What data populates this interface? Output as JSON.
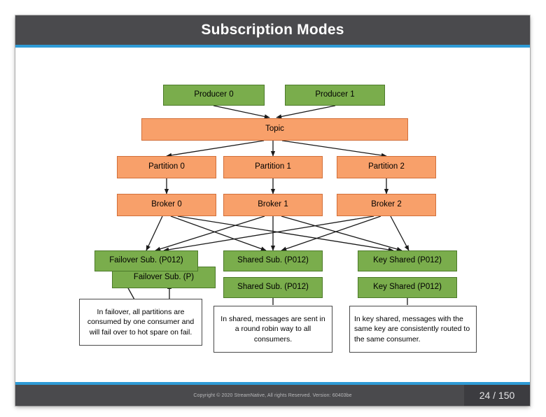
{
  "slide": {
    "title": "Subscription Modes",
    "counter": "24 / 150",
    "copyright": "Copyright © 2020 StreamNative, All rights Reserved. Version: 60403be",
    "accent_color": "#2e9bd6",
    "header_color": "#4a4a4d",
    "green_color": "#7aad4c",
    "orange_color": "#f8a06a"
  },
  "diagram": {
    "producers": [
      {
        "label": "Producer 0"
      },
      {
        "label": "Producer 1"
      }
    ],
    "topic": {
      "label": "Topic"
    },
    "partitions": [
      {
        "label": "Partition 0"
      },
      {
        "label": "Partition 1"
      },
      {
        "label": "Partition 2"
      }
    ],
    "brokers": [
      {
        "label": "Broker 0"
      },
      {
        "label": "Broker 1"
      },
      {
        "label": "Broker 2"
      }
    ],
    "subscriptions": {
      "failover": [
        {
          "label": "Failover Sub. (P012)"
        },
        {
          "label": "Failover Sub. (P)"
        }
      ],
      "shared": [
        {
          "label": "Shared Sub. (P012)"
        },
        {
          "label": "Shared Sub. (P012)"
        }
      ],
      "key_shared": [
        {
          "label": "Key Shared (P012)"
        },
        {
          "label": "Key Shared (P012)"
        }
      ]
    },
    "notes": [
      {
        "text": "In failover, all partitions are consumed by one consumer and will fail over to hot spare on fail."
      },
      {
        "text": "In shared, messages are sent in a round robin way to all consumers."
      },
      {
        "text": "In key shared, messages with the same key are consistently routed to the same consumer."
      }
    ]
  }
}
